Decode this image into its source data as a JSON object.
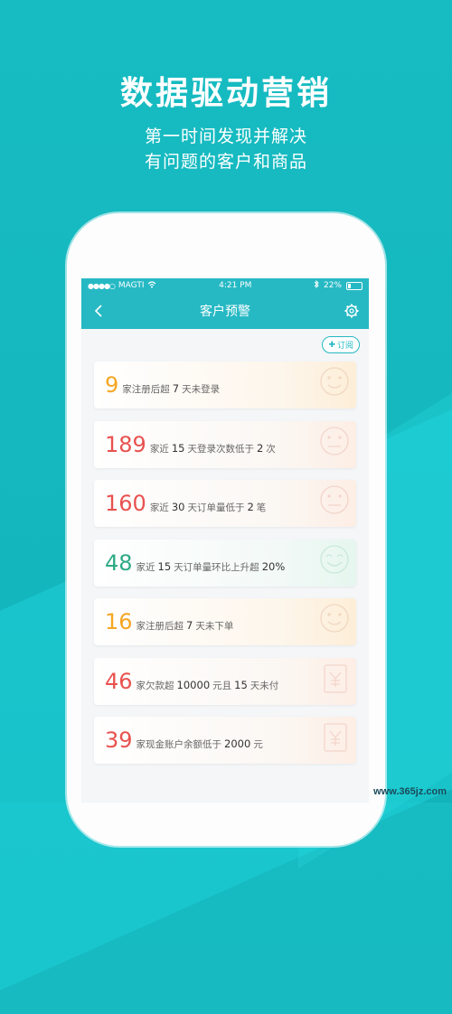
{
  "promo": {
    "headline": "数据驱动营销",
    "sub1": "第一时间发现并解决",
    "sub2": "有问题的客户和商品"
  },
  "statusbar": {
    "carrier": "MAGTI",
    "time": "4:21 PM",
    "battery": "22%"
  },
  "navbar": {
    "title": "客户预警"
  },
  "subscribe_label": "订阅",
  "cards": [
    {
      "num": "9",
      "color": "#f5a623",
      "p1": "家注册后超",
      "v1": "7",
      "p2": "天未登录",
      "icon": "smile-face-icon"
    },
    {
      "num": "189",
      "color": "#e8524f",
      "p1": "家近",
      "v1": "15",
      "p2": "天登录次数低于",
      "v2": "2",
      "p3": "次",
      "icon": "neutral-face-icon"
    },
    {
      "num": "160",
      "color": "#e8524f",
      "p1": "家近",
      "v1": "30",
      "p2": "天订单量低于",
      "v2": "2",
      "p3": "笔",
      "icon": "neutral-face-icon"
    },
    {
      "num": "48",
      "color": "#2eaa86",
      "p1": "家近",
      "v1": "15",
      "p2": "天订单量环比上升超",
      "v2": "20%",
      "icon": "happy-face-icon"
    },
    {
      "num": "16",
      "color": "#f5a623",
      "p1": "家注册后超",
      "v1": "7",
      "p2": "天未下单",
      "icon": "smile-face-icon"
    },
    {
      "num": "46",
      "color": "#e8524f",
      "p1": "家欠款超",
      "v1": "10000",
      "p2": "元且",
      "v2": "15",
      "p3": "天未付",
      "icon": "yen-document-icon"
    },
    {
      "num": "39",
      "color": "#e8524f",
      "p1": "家现金账户余额低于",
      "v1": "2000",
      "p2": "元",
      "icon": "yen-document-icon"
    }
  ],
  "watermark": "www.365jz.com"
}
